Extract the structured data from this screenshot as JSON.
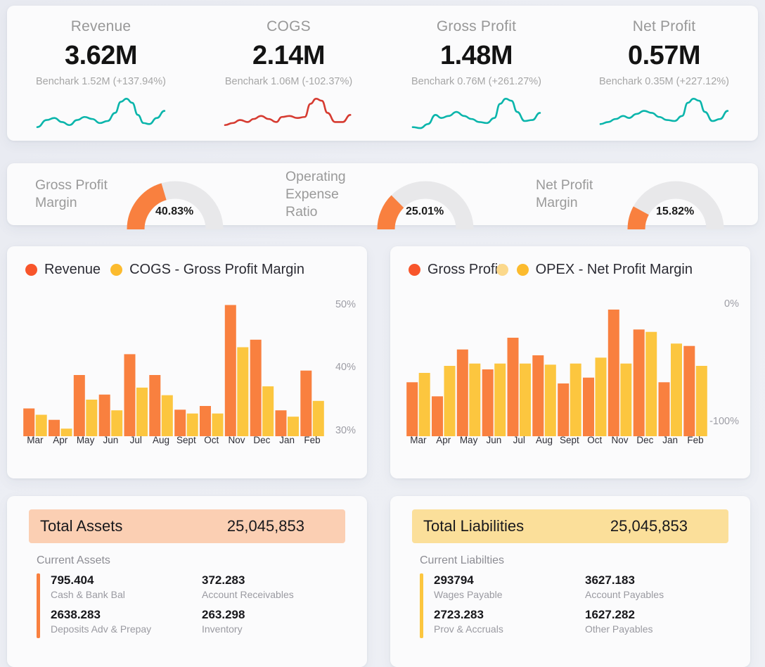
{
  "theme": {
    "page_bg": "#e9ebf2",
    "card_bg": "#fbfbfc",
    "accent_orange": "#f9803f",
    "accent_orange_bright": "#f8552b",
    "accent_yellow": "#fcc63f",
    "accent_yellow_light": "#fbd88b",
    "teal": "#0ab5ab",
    "red": "#d63b31",
    "gauge_track": "#e8e8ea",
    "assets_band": "#fbcfb3",
    "liabilities_band": "#fbdf9a"
  },
  "kpis": [
    {
      "label": "Revenue",
      "value": "3.62M",
      "benchmark": "Benchark 1.52M (+137.94%)",
      "spark_color": "#0ab5ab"
    },
    {
      "label": "COGS",
      "value": "2.14M",
      "benchmark": "Benchark 1.06M (-102.37%)",
      "spark_color": "#d63b31"
    },
    {
      "label": "Gross Profit",
      "value": "1.48M",
      "benchmark": "Benchark 0.76M (+261.27%)",
      "spark_color": "#0ab5ab"
    },
    {
      "label": "Net Profit",
      "value": "0.57M",
      "benchmark": "Benchark 0.35M (+227.12%)",
      "spark_color": "#0ab5ab"
    }
  ],
  "gauges": [
    {
      "title": "Gross Profit Margin",
      "value_label": "40.83%",
      "percent": 40.83
    },
    {
      "title": "Operating Expense Ratio",
      "value_label": "25.01%",
      "percent": 25.01
    },
    {
      "title": "Net Profit Margin",
      "value_label": "15.82%",
      "percent": 15.82
    }
  ],
  "chart_data": [
    {
      "type": "bar",
      "id": "revenue-cogs-chart",
      "title": "",
      "legend": [
        {
          "label": "Revenue",
          "color": "#f8552b"
        },
        {
          "label": "COGS - Gross Profit Margin",
          "color": "#fcbb2e"
        }
      ],
      "legend_position": "top-left",
      "xlabel": "",
      "ylabel": "",
      "categories": [
        "Mar",
        "Apr",
        "May",
        "Jun",
        "Jul",
        "Aug",
        "Sept",
        "Oct",
        "Nov",
        "Dec",
        "Jan",
        "Feb"
      ],
      "ytick_labels": [
        "50%",
        "40%",
        "30%"
      ],
      "ytick_values": [
        50,
        40,
        30
      ],
      "ylim": [
        29.2,
        51.5
      ],
      "grid": false,
      "series": [
        {
          "name": "Revenue",
          "color": "#f9803f",
          "values": [
            33.6,
            31.8,
            38.9,
            35.8,
            42.2,
            38.9,
            33.4,
            34.0,
            50.0,
            44.5,
            33.3,
            39.6
          ]
        },
        {
          "name": "COGS - Gross Profit Margin",
          "color": "#fcc63f",
          "values": [
            32.6,
            30.4,
            35.0,
            33.3,
            36.9,
            35.7,
            32.8,
            32.8,
            43.3,
            37.1,
            32.3,
            34.8
          ]
        }
      ]
    },
    {
      "type": "bar",
      "id": "grossprofit-opex-chart",
      "title": "",
      "legend": [
        {
          "label": "Gross Profit",
          "color": "#f8552b"
        },
        {
          "label": "",
          "color": "#fbd88b"
        },
        {
          "label": "OPEX - Net Profit Margin",
          "color": "#fcbb2e"
        }
      ],
      "legend_position": "top-left",
      "xlabel": "",
      "ylabel": "",
      "categories": [
        "Mar",
        "Apr",
        "May",
        "Jun",
        "Jul",
        "Aug",
        "Sept",
        "Oct",
        "Nov",
        "Dec",
        "Jan",
        "Feb"
      ],
      "ytick_labels": [
        "0%",
        "-100%"
      ],
      "ytick_values": [
        0,
        -100
      ],
      "ylim": [
        -112,
        8
      ],
      "grid": false,
      "series": [
        {
          "name": "Gross Profit",
          "color": "#f9803f",
          "values": [
            -66,
            -78,
            -38,
            -55,
            -28,
            -43,
            -67,
            -62,
            -4,
            -21,
            -66,
            -35
          ]
        },
        {
          "name": "OPEX - Net Profit Margin",
          "color": "#fcc63f",
          "values": [
            -58,
            -52,
            -50,
            -50,
            -50,
            -51,
            -50,
            -45,
            -50,
            -23,
            -33,
            -52
          ]
        }
      ]
    }
  ],
  "balance": {
    "assets": {
      "header_title": "Total Assets",
      "header_value": "25,045,853",
      "subtitle": "Current Assets",
      "accent_color": "#f9803f",
      "band_color": "#fbcfb3",
      "items": [
        {
          "value": "795.404",
          "label": "Cash & Bank Bal"
        },
        {
          "value": "372.283",
          "label": "Account Receivables"
        },
        {
          "value": "2638.283",
          "label": "Deposits Adv & Prepay"
        },
        {
          "value": "263.298",
          "label": "Inventory"
        }
      ]
    },
    "liabilities": {
      "header_title": "Total Liabilities",
      "header_value": "25,045,853",
      "subtitle": "Current Liabilties",
      "accent_color": "#fcc63f",
      "band_color": "#fbdf9a",
      "items": [
        {
          "value": "293794",
          "label": "Wages Payable"
        },
        {
          "value": "3627.183",
          "label": "Account Payables"
        },
        {
          "value": "2723.283",
          "label": "Prov & Accruals"
        },
        {
          "value": "1627.282",
          "label": "Other Payables"
        }
      ]
    }
  }
}
